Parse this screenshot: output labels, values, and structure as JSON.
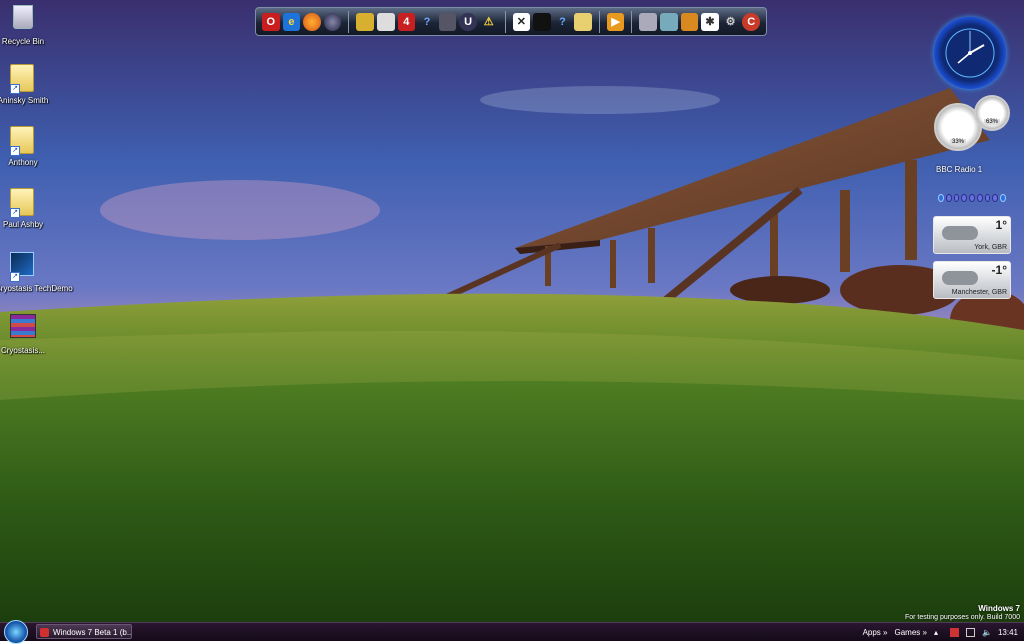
{
  "desktop": {
    "icons": [
      {
        "label": "Recycle Bin",
        "icon": "recycle-bin-icon"
      },
      {
        "label": "Aninsky Smith",
        "icon": "folder-icon"
      },
      {
        "label": "Anthony",
        "icon": "folder-icon"
      },
      {
        "label": "Paul Ashby",
        "icon": "folder-icon"
      },
      {
        "label": "Cryostasis TechDemo",
        "icon": "cryostasis-icon"
      },
      {
        "label": "Cryostasis...",
        "icon": "winrar-archive-icon"
      }
    ]
  },
  "dock": {
    "items": [
      "opera-icon",
      "internet-explorer-icon",
      "firefox-icon",
      "globe-icon",
      "game-icon",
      "crysis-icon",
      "left4dead-icon",
      "help-icon",
      "game2-icon",
      "unreal-icon",
      "warning-icon",
      "xfire-icon",
      "steam-icon",
      "help2-icon",
      "folder-icon",
      "media-player-icon",
      "recycle-bin-icon",
      "control-panel-icon",
      "photo-icon",
      "fan-icon",
      "settings-icon",
      "ccleaner-icon"
    ]
  },
  "gadgets": {
    "meter": {
      "cpu": "33%",
      "ram": "63%"
    },
    "radio": {
      "title": "BBC Radio 1"
    },
    "weather": [
      {
        "temp": "1°",
        "city": "York, GBR"
      },
      {
        "temp": "-1°",
        "city": "Manchester, GBR"
      }
    ]
  },
  "watermark": {
    "line1": "Windows 7",
    "line2": "For testing purposes only. Build 7000"
  },
  "taskbar": {
    "task_label": "Windows 7 Beta 1 (b...",
    "apps_label": "Apps",
    "games_label": "Games",
    "clock": "13:41"
  },
  "colors": {
    "accent": "#1a4fd6",
    "taskbar": "#1c0f22"
  }
}
